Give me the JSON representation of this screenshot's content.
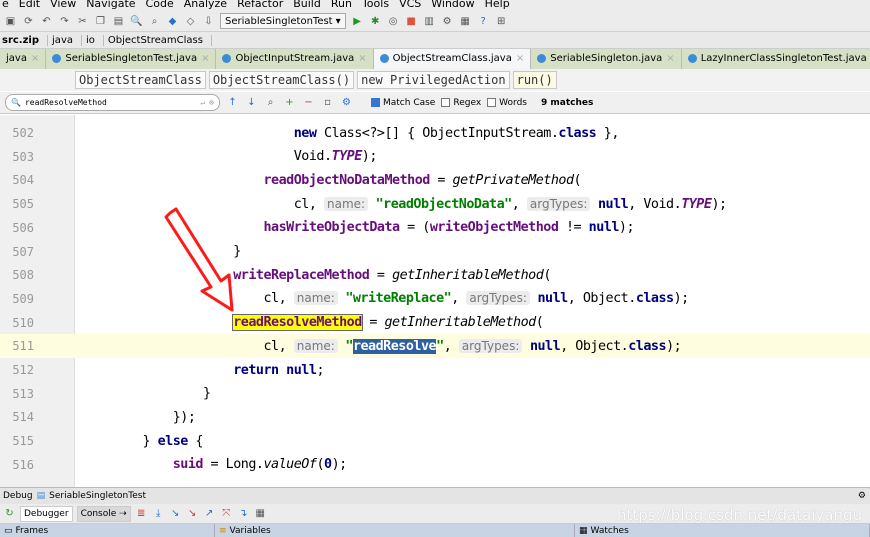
{
  "menu": [
    "e",
    "Edit",
    "View",
    "Navigate",
    "Code",
    "Analyze",
    "Refactor",
    "Build",
    "Run",
    "Tools",
    "VCS",
    "Window",
    "Help"
  ],
  "toolbar": {
    "run_config": "SeriableSingletonTest"
  },
  "breadcrumbs": [
    "src.zip",
    "java",
    "io",
    "ObjectStreamClass"
  ],
  "tabs": [
    {
      "label": "java",
      "selected": false
    },
    {
      "label": "SeriableSingletonTest.java",
      "selected": false
    },
    {
      "label": "ObjectInputStream.java",
      "selected": false
    },
    {
      "label": "ObjectStreamClass.java",
      "selected": true
    },
    {
      "label": "SeriableSingleton.java",
      "selected": false
    },
    {
      "label": "LazyInnerClassSingletonTest.java",
      "selected": false
    }
  ],
  "structure": [
    "ObjectStreamClass",
    "ObjectStreamClass()",
    "new PrivilegedAction",
    "run()"
  ],
  "search": {
    "query": "readResolveMethod",
    "match_case_label": "Match Case",
    "match_case": true,
    "regex_label": "Regex",
    "regex": false,
    "words_label": "Words",
    "words": false,
    "matches": "9 matches"
  },
  "code": [
    {
      "n": "502",
      "tokens": [
        {
          "t": "                            "
        },
        {
          "t": "new ",
          "c": "kw"
        },
        {
          "t": "Class<?>[] { ObjectInputStream."
        },
        {
          "t": "class",
          "c": "kw"
        },
        {
          "t": " },"
        }
      ]
    },
    {
      "n": "503",
      "tokens": [
        {
          "t": "                            Void."
        },
        {
          "t": "TYPE",
          "c": "sfld"
        },
        {
          "t": ");"
        }
      ]
    },
    {
      "n": "504",
      "tokens": [
        {
          "t": "                        "
        },
        {
          "t": "readObjectNoDataMethod",
          "c": "fld"
        },
        {
          "t": " = "
        },
        {
          "t": "getPrivateMethod",
          "c": "it"
        },
        {
          "t": "("
        }
      ]
    },
    {
      "n": "505",
      "tokens": [
        {
          "t": "                            cl, "
        },
        {
          "t": "name:",
          "c": "hint"
        },
        {
          "t": " "
        },
        {
          "t": "\"readObjectNoData\"",
          "c": "str"
        },
        {
          "t": ", "
        },
        {
          "t": "argTypes:",
          "c": "hint"
        },
        {
          "t": " "
        },
        {
          "t": "null",
          "c": "kw"
        },
        {
          "t": ", Void."
        },
        {
          "t": "TYPE",
          "c": "sfld"
        },
        {
          "t": ");"
        }
      ]
    },
    {
      "n": "506",
      "tokens": [
        {
          "t": "                        "
        },
        {
          "t": "hasWriteObjectData",
          "c": "fld"
        },
        {
          "t": " = ("
        },
        {
          "t": "writeObjectMethod",
          "c": "fld"
        },
        {
          "t": " != "
        },
        {
          "t": "null",
          "c": "kw"
        },
        {
          "t": ");"
        }
      ]
    },
    {
      "n": "507",
      "tokens": [
        {
          "t": "                    }"
        }
      ]
    },
    {
      "n": "508",
      "tokens": [
        {
          "t": "                    "
        },
        {
          "t": "writeReplaceMethod",
          "c": "fld"
        },
        {
          "t": " = "
        },
        {
          "t": "getInheritableMethod",
          "c": "it"
        },
        {
          "t": "("
        }
      ]
    },
    {
      "n": "509",
      "tokens": [
        {
          "t": "                        cl, "
        },
        {
          "t": "name:",
          "c": "hint"
        },
        {
          "t": " "
        },
        {
          "t": "\"writeReplace\"",
          "c": "str"
        },
        {
          "t": ", "
        },
        {
          "t": "argTypes:",
          "c": "hint"
        },
        {
          "t": " "
        },
        {
          "t": "null",
          "c": "kw"
        },
        {
          "t": ", Object."
        },
        {
          "t": "class",
          "c": "kw"
        },
        {
          "t": ");"
        }
      ]
    },
    {
      "n": "510",
      "tokens": [
        {
          "t": "                    "
        },
        {
          "t": "readResolveMethod",
          "c": "fld m1"
        },
        {
          "t": " = "
        },
        {
          "t": "getInheritableMethod",
          "c": "it"
        },
        {
          "t": "("
        }
      ]
    },
    {
      "n": "511",
      "current": true,
      "tokens": [
        {
          "t": "                        cl, "
        },
        {
          "t": "name:",
          "c": "hint"
        },
        {
          "t": " "
        },
        {
          "t": "\"",
          "c": "str"
        },
        {
          "t": "readResolve",
          "c": "str m2"
        },
        {
          "t": "\"",
          "c": "str"
        },
        {
          "t": ", "
        },
        {
          "t": "argTypes:",
          "c": "hint"
        },
        {
          "t": " "
        },
        {
          "t": "null",
          "c": "kw"
        },
        {
          "t": ", Object."
        },
        {
          "t": "class",
          "c": "kw"
        },
        {
          "t": ");"
        }
      ]
    },
    {
      "n": "512",
      "tokens": [
        {
          "t": "                    "
        },
        {
          "t": "return null",
          "c": "kw"
        },
        {
          "t": ";"
        }
      ]
    },
    {
      "n": "513",
      "tokens": [
        {
          "t": "                }"
        }
      ]
    },
    {
      "n": "514",
      "tokens": [
        {
          "t": "            });"
        }
      ]
    },
    {
      "n": "515",
      "tokens": [
        {
          "t": "        } "
        },
        {
          "t": "else",
          "c": "kw"
        },
        {
          "t": " {"
        }
      ]
    },
    {
      "n": "516",
      "tokens": [
        {
          "t": "            "
        },
        {
          "t": "suid",
          "c": "fld"
        },
        {
          "t": " = Long."
        },
        {
          "t": "valueOf",
          "c": "it"
        },
        {
          "t": "("
        },
        {
          "t": "0",
          "c": "kw"
        },
        {
          "t": ");"
        }
      ]
    }
  ],
  "debug": {
    "title": "Debug",
    "config": "SeriableSingletonTest",
    "tabs": [
      "Debugger",
      "Console"
    ],
    "panes": [
      "Frames",
      "Variables",
      "Watches"
    ]
  },
  "watermark": "https://blog.csdn.net/dataiyangu",
  "colors": {
    "annotation_arrow": "#ff1a1a",
    "search_highlight": "#ffff00",
    "selection": "#2e5fa3"
  }
}
